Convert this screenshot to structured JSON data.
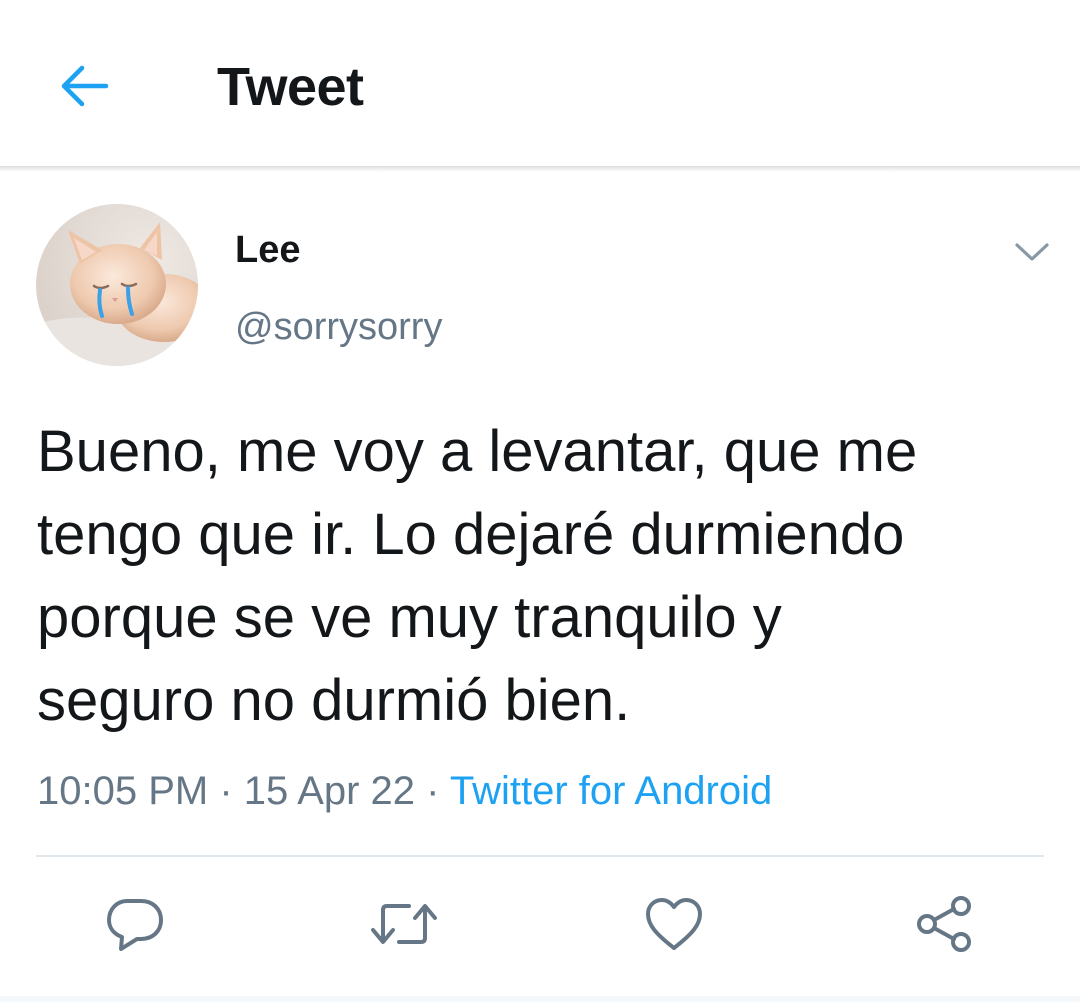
{
  "header": {
    "title": "Tweet",
    "back_icon": "back-arrow-icon"
  },
  "author": {
    "name": "Lee",
    "handle": "@sorrysorry",
    "avatar_icon": "crying-cat-avatar"
  },
  "tweet": {
    "text": "Bueno, me voy a levantar, que me\ntengo que ir. Lo dejaré durmiendo\nporque se ve muy tranquilo y\nseguro no durmió bien.",
    "time": "10:05 PM",
    "date": "15 Apr 22",
    "separator": "·",
    "source": "Twitter for Android"
  },
  "actions": {
    "reply_icon": "reply-icon",
    "retweet_icon": "retweet-icon",
    "like_icon": "heart-icon",
    "share_icon": "share-icon"
  },
  "colors": {
    "accent": "#1da1f2",
    "text": "#14171a",
    "secondary": "#657786",
    "icon": "#657786"
  }
}
